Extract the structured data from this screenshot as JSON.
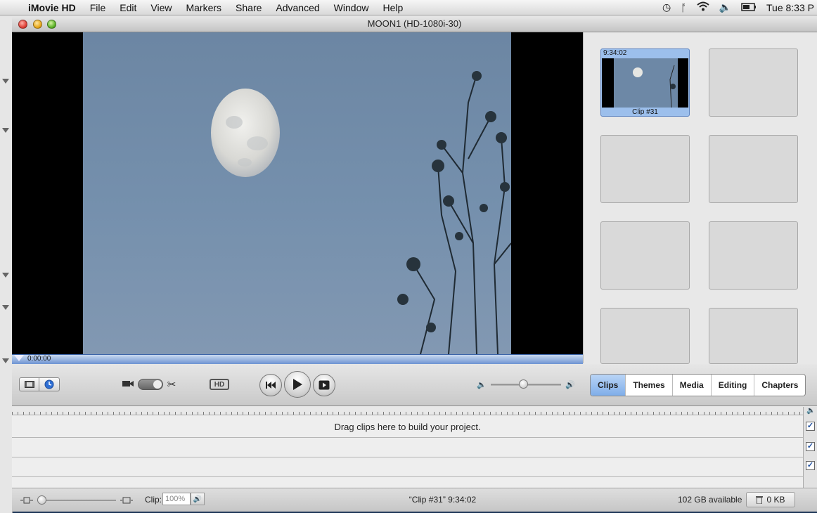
{
  "menubar": {
    "app_name": "iMovie HD",
    "items": [
      "File",
      "Edit",
      "View",
      "Markers",
      "Share",
      "Advanced",
      "Window",
      "Help"
    ],
    "clock": "Tue 8:33 P"
  },
  "window": {
    "title": "MOON1 (HD-1080i-30)"
  },
  "viewer": {
    "timecode": "0:00:00"
  },
  "shelf": {
    "clip": {
      "time": "9:34:02",
      "name": "Clip #31"
    }
  },
  "controls": {
    "hd_label": "HD"
  },
  "tabs": [
    "Clips",
    "Themes",
    "Media",
    "Editing",
    "Chapters"
  ],
  "timeline": {
    "hint": "Drag clips here to build your project."
  },
  "status": {
    "clip_label": "Clip:",
    "clip_volume": "100%",
    "clip_info": "“Clip #31”  9:34:02",
    "available": "102 GB available",
    "trash": "0 KB"
  },
  "colors": {
    "selected_tab": "#7faee9",
    "scrubber": "#6d94d3",
    "sky": "#7590ad"
  }
}
